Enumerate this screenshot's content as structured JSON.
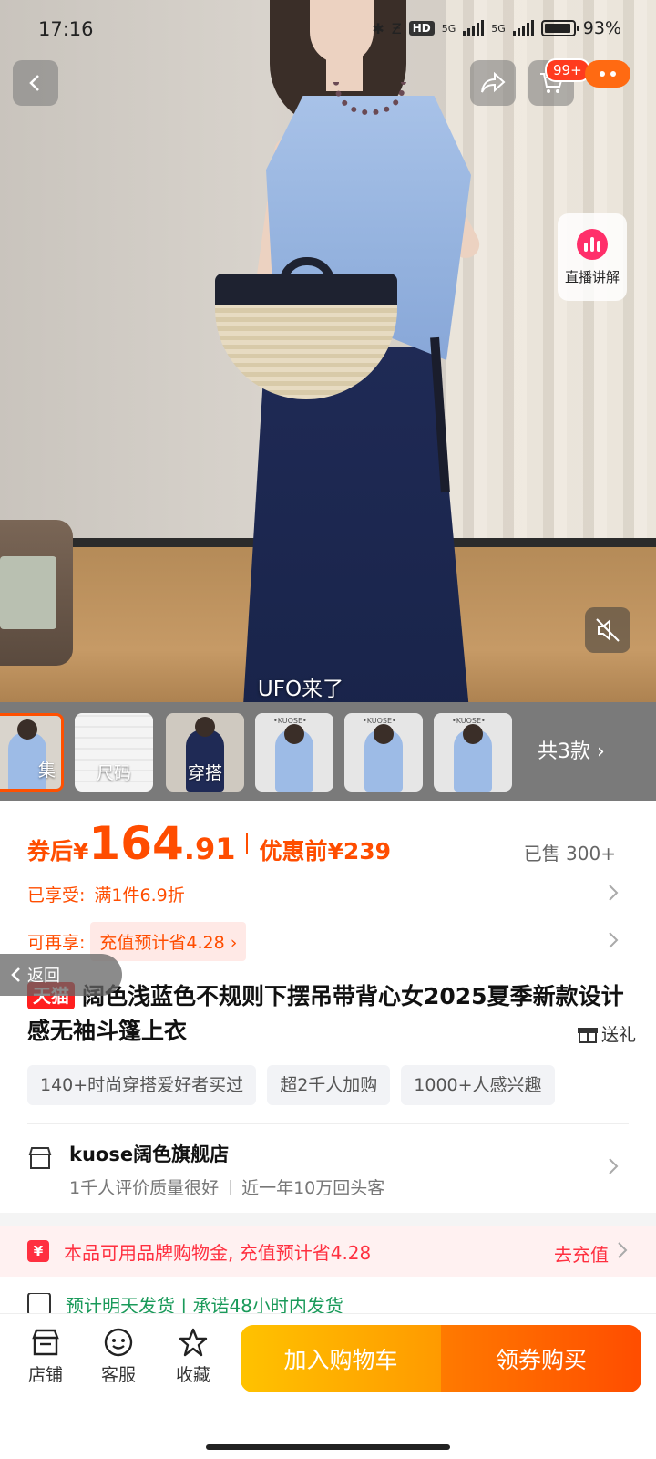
{
  "status_bar": {
    "time": "17:16",
    "battery": "93%",
    "network": "5G",
    "hd": "HD"
  },
  "hero": {
    "caption": "UFO来了",
    "cart_badge": "99+",
    "live_label": "直播讲解"
  },
  "thumbnails": [
    {
      "label": "集",
      "active": true
    },
    {
      "label": "尺码",
      "active": false
    },
    {
      "label": "穿搭",
      "active": false
    },
    {
      "label": "",
      "active": false
    },
    {
      "label": "",
      "active": false
    },
    {
      "label": "",
      "active": false
    }
  ],
  "thumbnail_tag": "•KUOSE•",
  "all_styles": "共3款",
  "price": {
    "prefix": "券后",
    "currency": "¥",
    "integer": "164",
    "decimal": ".91",
    "before_label": "优惠前¥239",
    "sold": "已售 300+"
  },
  "promos": {
    "enjoyed_label": "已享受:",
    "enjoyed_value": "满1件6.9折",
    "more_label": "可再享:",
    "more_value": "充值预计省4.28 ›"
  },
  "back_float_label": "返回",
  "product": {
    "badge": "天猫",
    "title": "阔色浅蓝色不规则下摆吊带背心女2025夏季新款设计感无袖斗篷上衣",
    "gift": "送礼"
  },
  "tags": [
    "140+时尚穿搭爱好者买过",
    "超2千人加购",
    "1000+人感兴趣"
  ],
  "store": {
    "name": "kuose阔色旗舰店",
    "sub1": "1千人评价质量很好",
    "sub2": "近一年10万回头客"
  },
  "brand_credit": {
    "icon": "¥",
    "text": "本品可用品牌购物金, 充值预计省4.28",
    "action": "去充值"
  },
  "shipping": {
    "text": "预计明天发货 | 承诺48小时内发货"
  },
  "bottom_bar": {
    "shop": "店铺",
    "service": "客服",
    "favorite": "收藏",
    "add_to_cart": "加入购物车",
    "buy": "领券购买"
  },
  "colors": {
    "accent": "#ff4d00",
    "tmall": "#ff1f1f",
    "cart_button": "#ffb000",
    "buy_button": "#ff5a00"
  }
}
